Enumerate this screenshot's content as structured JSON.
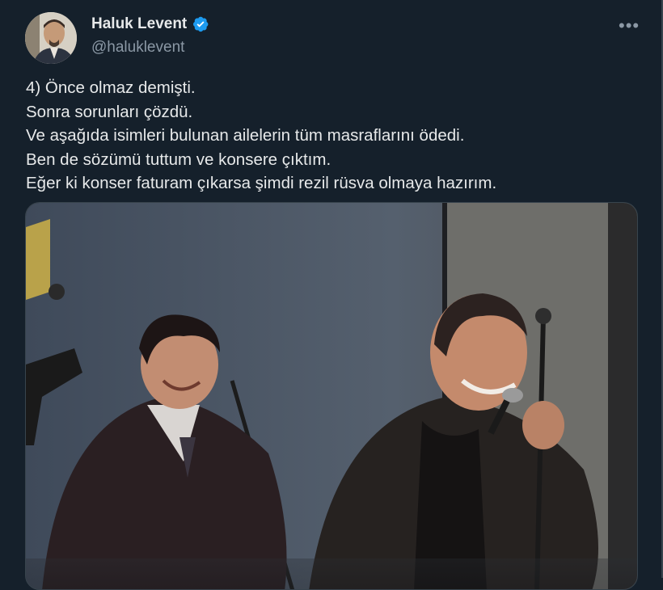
{
  "author": {
    "display_name": "Haluk Levent",
    "handle": "@haluklevent",
    "verified": true,
    "verified_icon": "verified-badge-icon",
    "avatar_icon": "avatar-photo"
  },
  "menu": {
    "more_label": "•••",
    "icon": "more-options-icon"
  },
  "tweet": {
    "lines": [
      "4) Önce olmaz demişti.",
      "Sonra sorunları çözdü.",
      "Ve aşağıda isimleri bulunan ailelerin tüm masraflarını ödedi.",
      "Ben de sözümü tuttum ve konsere çıktım.",
      "Eğer ki konser faturam çıkarsa şimdi rezil rüsva olmaya hazırım."
    ]
  },
  "colors": {
    "background": "#15202b",
    "text": "#e7e9ea",
    "secondary": "#8b98a5",
    "verified": "#1d9bf0"
  }
}
